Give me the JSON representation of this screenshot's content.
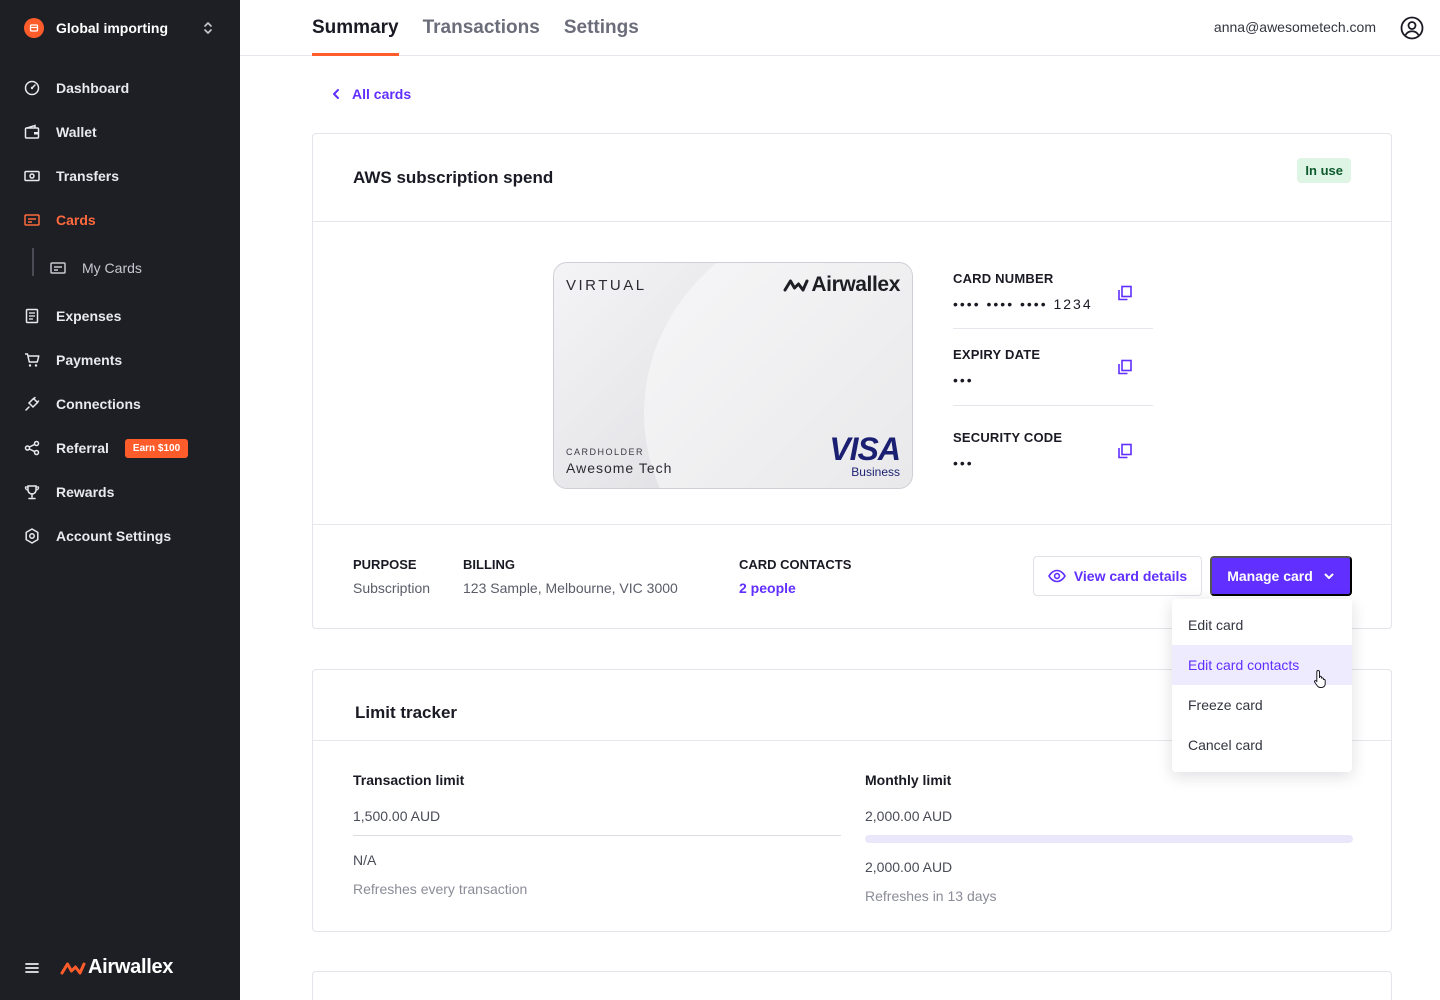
{
  "sidebar": {
    "org_name": "Global importing",
    "items": [
      {
        "label": "Dashboard"
      },
      {
        "label": "Wallet"
      },
      {
        "label": "Transfers"
      },
      {
        "label": "Cards"
      },
      {
        "label": "My Cards"
      },
      {
        "label": "Expenses"
      },
      {
        "label": "Payments"
      },
      {
        "label": "Connections"
      },
      {
        "label": "Referral",
        "badge": "Earn $100"
      },
      {
        "label": "Rewards"
      },
      {
        "label": "Account Settings"
      }
    ],
    "brand": "Airwallex",
    "accent_color": "#ff5c2b"
  },
  "header": {
    "tabs": [
      {
        "label": "Summary"
      },
      {
        "label": "Transactions"
      },
      {
        "label": "Settings"
      }
    ],
    "user_email": "anna@awesometech.com"
  },
  "back_link": "All cards",
  "card": {
    "title": "AWS subscription spend",
    "status": "In use",
    "visual": {
      "type_label": "VIRTUAL",
      "issuer": "Airwallex",
      "cardholder_label": "CARDHOLDER",
      "cardholder": "Awesome Tech",
      "network": "VISA",
      "network_tier": "Business"
    },
    "details": {
      "number_label": "CARD NUMBER",
      "number_value": "•••• •••• ••••  1234",
      "expiry_label": "EXPIRY DATE",
      "expiry_value": "•••",
      "cvc_label": "SECURITY CODE",
      "cvc_value": "•••"
    },
    "meta": {
      "purpose_label": "PURPOSE",
      "purpose_value": "Subscription",
      "billing_label": "BILLING",
      "billing_value": "123 Sample, Melbourne, VIC 3000",
      "contacts_label": "CARD CONTACTS",
      "contacts_value": "2 people"
    },
    "view_details_label": "View card details",
    "manage_label": "Manage card",
    "primary_color": "#612fff"
  },
  "manage_menu": {
    "items": [
      {
        "label": "Edit card"
      },
      {
        "label": "Edit card contacts"
      },
      {
        "label": "Freeze card"
      },
      {
        "label": "Cancel card"
      }
    ],
    "hovered_index": 1
  },
  "limit_tracker": {
    "title": "Limit tracker",
    "transaction": {
      "title": "Transaction limit",
      "limit": "1,500.00 AUD",
      "remaining": "N/A",
      "refresh": "Refreshes every transaction"
    },
    "monthly": {
      "title": "Monthly limit",
      "limit": "2,000.00 AUD",
      "remaining": "2,000.00 AUD",
      "refresh": "Refreshes in 13 days",
      "used_fraction": 0
    }
  }
}
